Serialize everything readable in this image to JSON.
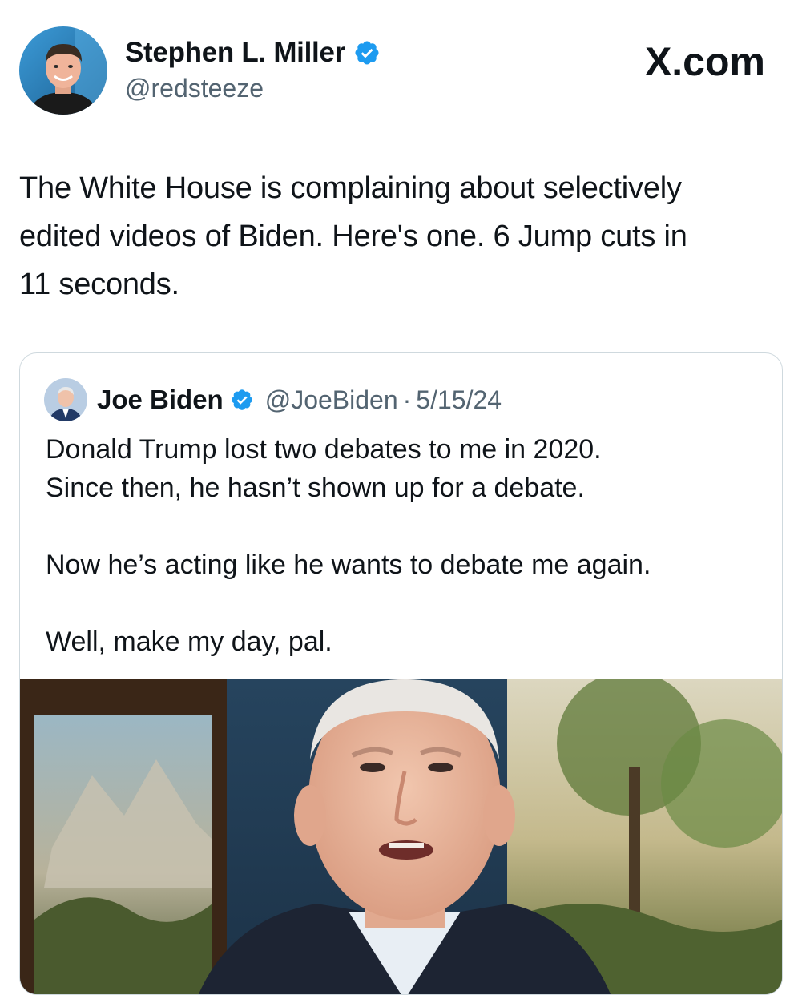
{
  "post": {
    "author": {
      "name": "Stephen L. Miller",
      "handle": "@redsteeze",
      "verified": true
    },
    "source_logo": "X.com",
    "text_lines": [
      "The White House is complaining about selectively",
      "edited videos of Biden. Here's one. 6 Jump cuts in",
      "11 seconds."
    ]
  },
  "quoted_post": {
    "author": {
      "name": "Joe Biden",
      "handle": "@JoeBiden",
      "verified": true
    },
    "separator": "·",
    "date": "5/15/24",
    "paragraphs": [
      [
        "Donald Trump lost two debates to me in 2020.",
        "Since then, he hasn’t shown up for a debate."
      ],
      [
        "Now he’s acting like he wants to debate me again."
      ],
      [
        "Well, make my day, pal."
      ]
    ],
    "media": {
      "type": "video-still"
    }
  },
  "colors": {
    "text_primary": "#0f1419",
    "text_secondary": "#536471",
    "verified_blue": "#1d9bf0",
    "card_border": "#cfd9de"
  }
}
